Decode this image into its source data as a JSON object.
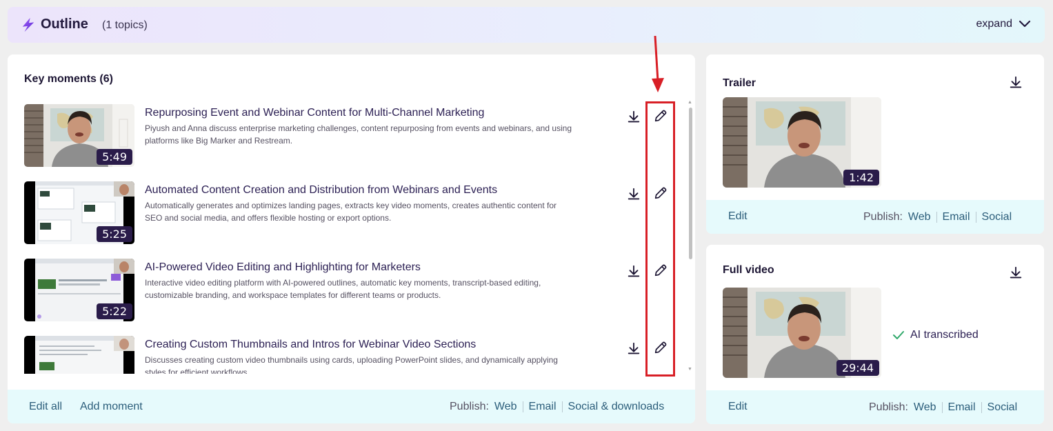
{
  "outline": {
    "title": "Outline",
    "count": "(1 topics)",
    "expand_label": "expand"
  },
  "key_moments": {
    "title": "Key moments (6)",
    "items": [
      {
        "title": "Repurposing Event and Webinar Content for Multi-Channel Marketing",
        "description": "Piyush and Anna discuss enterprise marketing challenges, content repurposing from events and webinars, and using platforms like Big Marker and Restream.",
        "duration": "5:49"
      },
      {
        "title": "Automated Content Creation and Distribution from Webinars and Events",
        "description": "Automatically generates and optimizes landing pages, extracts key video moments, creates authentic content for SEO and social media, and offers flexible hosting or export options.",
        "duration": "5:25"
      },
      {
        "title": "AI-Powered Video Editing and Highlighting for Marketers",
        "description": "Interactive video editing platform with AI-powered outlines, automatic key moments, transcript-based editing, customizable branding, and workspace templates for different teams or products.",
        "duration": "5:22"
      },
      {
        "title": "Creating Custom Thumbnails and Intros for Webinar Video Sections",
        "description": "Discusses creating custom video thumbnails using cards, uploading PowerPoint slides, and dynamically applying styles for efficient workflows.",
        "duration": ""
      }
    ],
    "footer": {
      "edit_all": "Edit all",
      "add_moment": "Add moment",
      "publish_label": "Publish:",
      "web": "Web",
      "email": "Email",
      "social": "Social & downloads"
    }
  },
  "trailer": {
    "title": "Trailer",
    "duration": "1:42",
    "edit": "Edit",
    "publish_label": "Publish:",
    "web": "Web",
    "email": "Email",
    "social": "Social"
  },
  "full_video": {
    "title": "Full video",
    "duration": "29:44",
    "status": "AI transcribed",
    "edit": "Edit",
    "publish_label": "Publish:",
    "web": "Web",
    "email": "Email",
    "social": "Social"
  },
  "colors": {
    "accent": "#7b3fe4",
    "link": "#2b5d7a",
    "annotation": "#d81f26",
    "footer_bg": "#e6fafc"
  }
}
